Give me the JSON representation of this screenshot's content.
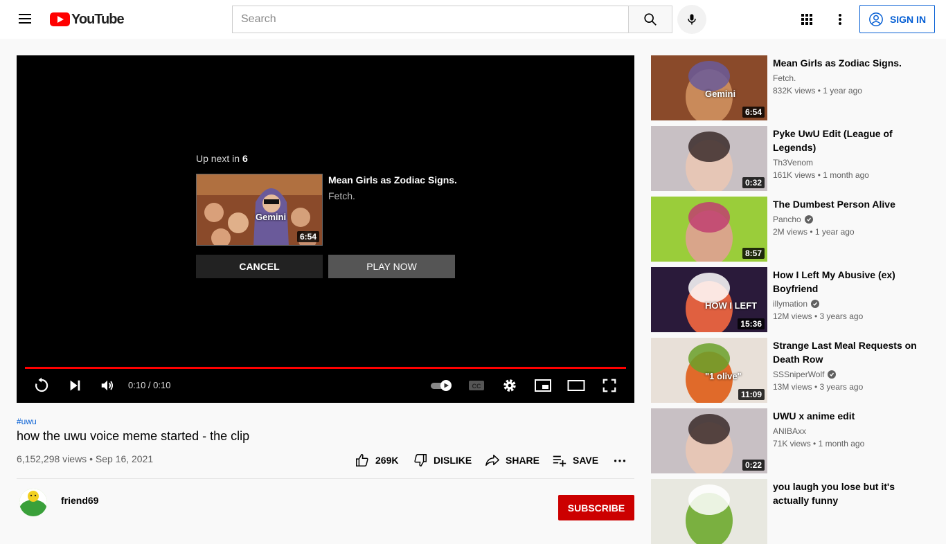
{
  "header": {
    "logo_text": "YouTube",
    "search_placeholder": "Search",
    "signin_label": "SIGN IN"
  },
  "player": {
    "upnext_prefix": "Up next in",
    "upnext_countdown": "6",
    "upnext_title": "Mean Girls as Zodiac Signs.",
    "upnext_channel": "Fetch.",
    "upnext_thumb_caption": "Gemini",
    "upnext_duration": "6:54",
    "cancel_label": "CANCEL",
    "playnow_label": "PLAY NOW",
    "time_display": "0:10 / 0:10",
    "progress_fraction": 1.0
  },
  "video": {
    "hashtag": "#uwu",
    "title": "how the uwu voice meme started - the clip",
    "views_date": "6,152,298 views • Sep 16, 2021",
    "like_count": "269K",
    "dislike_label": "DISLIKE",
    "share_label": "SHARE",
    "save_label": "SAVE",
    "channel_name": "friend69",
    "subscribe_label": "SUBSCRIBE"
  },
  "recommendations": [
    {
      "title_lines": [
        "Mean Girls as Zodiac Signs."
      ],
      "channel": "Fetch.",
      "verified": false,
      "meta": "832K views • 1 year ago",
      "duration": "6:54",
      "caption": "Gemini",
      "palette": [
        "#8a4a2a",
        "#c98a5a",
        "#6a5a9a"
      ]
    },
    {
      "title_lines": [
        "Pyke UwU Edit (League of",
        "Legends)"
      ],
      "channel": "Th3Venom",
      "verified": false,
      "meta": "161K views • 1 month ago",
      "duration": "0:32",
      "caption": "",
      "palette": [
        "#c8c0c4",
        "#e6c6b6",
        "#3a2a2a"
      ]
    },
    {
      "title_lines": [
        "The Dumbest Person Alive"
      ],
      "channel": "Pancho",
      "verified": true,
      "meta": "2M views • 1 year ago",
      "duration": "8:57",
      "caption": "",
      "palette": [
        "#9acd3a",
        "#d9a58a",
        "#c04070"
      ]
    },
    {
      "title_lines": [
        "How I Left My Abusive (ex)",
        "Boyfriend"
      ],
      "channel": "illymation",
      "verified": true,
      "meta": "12M views • 3 years ago",
      "duration": "15:36",
      "caption": "HOW I LEFT",
      "palette": [
        "#2a1a3a",
        "#e06040",
        "#ffffff"
      ]
    },
    {
      "title_lines": [
        "Strange Last Meal Requests on",
        "Death Row"
      ],
      "channel": "SSSniperWolf",
      "verified": true,
      "meta": "13M views • 3 years ago",
      "duration": "11:09",
      "caption": "\"1 olive\"",
      "palette": [
        "#e8e0d8",
        "#e06a2a",
        "#6aa02a"
      ]
    },
    {
      "title_lines": [
        "UWU x anime edit"
      ],
      "channel": "ANIBAxx",
      "verified": false,
      "meta": "71K views • 1 month ago",
      "duration": "0:22",
      "caption": "",
      "palette": [
        "#c8c0c4",
        "#e6c6b6",
        "#3a2a2a"
      ]
    },
    {
      "title_lines": [
        "you laugh you lose but it's",
        "actually funny"
      ],
      "channel": "",
      "verified": false,
      "meta": "",
      "duration": "",
      "caption": "",
      "palette": [
        "#e8e8e0",
        "#7ab040",
        "#ffffff"
      ]
    }
  ]
}
